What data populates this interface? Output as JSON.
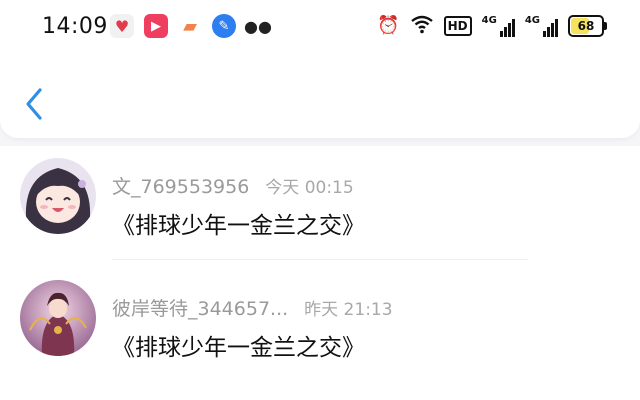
{
  "status_bar": {
    "time": "14:09",
    "battery_label": "68",
    "battery_level": 0.68,
    "network_label_1": "4G",
    "network_label_2": "4G",
    "hd_label": "HD",
    "app_icons": [
      "weibo-heart-icon",
      "video-play-icon",
      "game-controller-icon",
      "feather-icon",
      "wechat-icon"
    ]
  },
  "header": {
    "back_icon": "chevron-left-icon",
    "accent_color": "#2f8ee6"
  },
  "comments": [
    {
      "username": "文_769553956",
      "timestamp": "今天 00:15",
      "text": "《排球少年一金兰之交》"
    },
    {
      "username": "彼岸等待_344657...",
      "timestamp": "昨天 21:13",
      "text": "《排球少年一金兰之交》"
    }
  ]
}
